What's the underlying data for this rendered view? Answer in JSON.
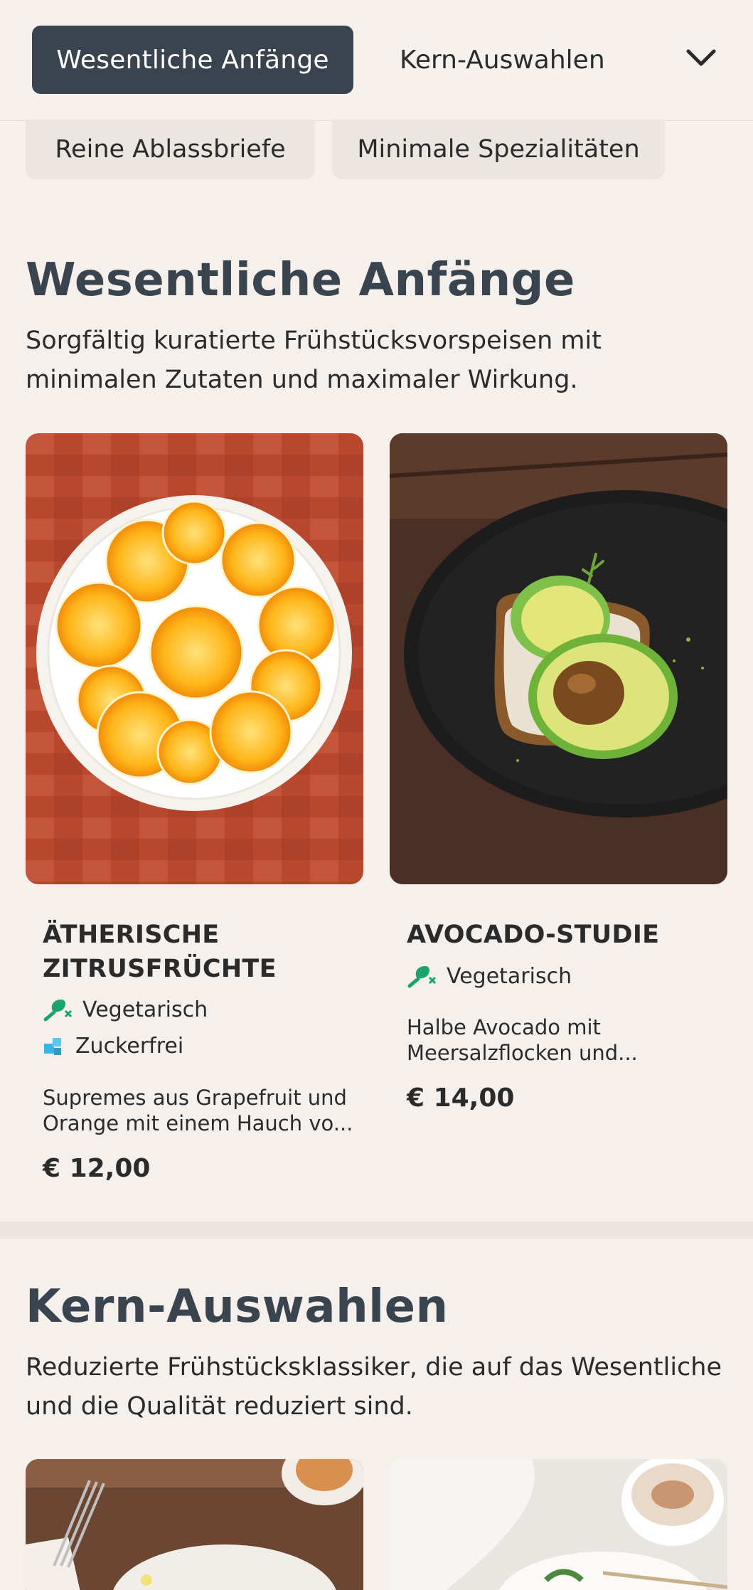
{
  "nav": {
    "tabs": [
      {
        "label": "Wesentliche Anfänge",
        "active": true
      },
      {
        "label": "Kern-Auswahlen",
        "active": false
      }
    ],
    "subtabs": [
      {
        "label": "Reine Ablassbriefe"
      },
      {
        "label": "Minimale Spezialitäten"
      }
    ],
    "more_icon": "chevron-down-icon"
  },
  "sections": [
    {
      "title": "Wesentliche Anfänge",
      "description": "Sorgfältig kuratierte Frühstücksvorspeisen mit minimalen Zutaten und maximaler Wirkung.",
      "items": [
        {
          "title": "ÄTHERISCHE ZITRUSFRÜCHTE",
          "tags": [
            {
              "label": "Vegetarisch",
              "icon": "vegetarian-icon"
            },
            {
              "label": "Zuckerfrei",
              "icon": "sugar-free-icon"
            }
          ],
          "description": "Supremes aus Grapefruit und Orange mit einem Hauch vo...",
          "price": "€ 12,00"
        },
        {
          "title": "AVOCADO-STUDIE",
          "tags": [
            {
              "label": "Vegetarisch",
              "icon": "vegetarian-icon"
            }
          ],
          "description": "Halbe Avocado mit Meersalzflocken und...",
          "price": "€ 14,00"
        }
      ]
    },
    {
      "title": "Kern-Auswahlen",
      "description": "Reduzierte Frühstücksklassiker, die auf das Wesentliche und die Qualität reduziert sind."
    }
  ],
  "colors": {
    "background": "#f5f0ec",
    "active_tab": "#3a444f",
    "heading": "#3a444f",
    "tag_green": "#1aa36b",
    "tag_blue": "#3ab4e6"
  }
}
